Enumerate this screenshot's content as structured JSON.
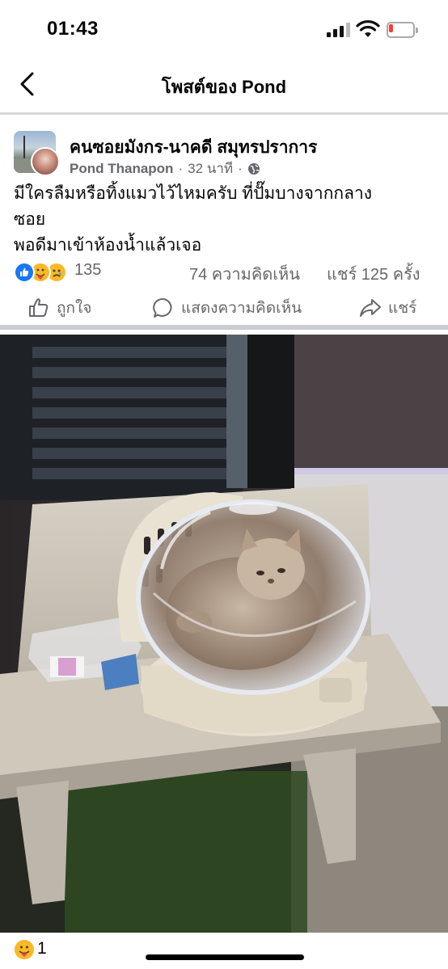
{
  "status_bar": {
    "time": "01:43",
    "battery_color": "#ff3b30"
  },
  "nav": {
    "title": "โพสต์ของ Pond",
    "back_icon": "chevron-left-icon"
  },
  "post": {
    "group_name": "คนซอยมังกร-นาคดี สมุทรปราการ",
    "author": "Pond Thanapon",
    "time_ago": "32 นาที",
    "separator": "·",
    "privacy_icon": "globe-icon",
    "text_line_1": "มีใครลืมหรือทิ้งแมวไว้ไหมครับ ที่ปั๊มบางจากกลาง",
    "text_line_2": "ซอย",
    "text_line_3": "พอดีมาเข้าห้องน้ำแล้วเจอ",
    "reaction_count": "135",
    "comment_count": "74 ความคิดเห็น",
    "share_count": "แชร์ 125 ครั้ง"
  },
  "actions": {
    "like_label": "ถูกใจ",
    "comment_label": "แสดงความคิดเห็น",
    "share_label": "แชร์"
  },
  "bottom": {
    "reaction_count": "1"
  },
  "colors": {
    "like_blue": "#1877f2",
    "reaction_yellow": "#f7b928",
    "secondary_text": "#65676b",
    "divider": "#c9ccd1"
  }
}
